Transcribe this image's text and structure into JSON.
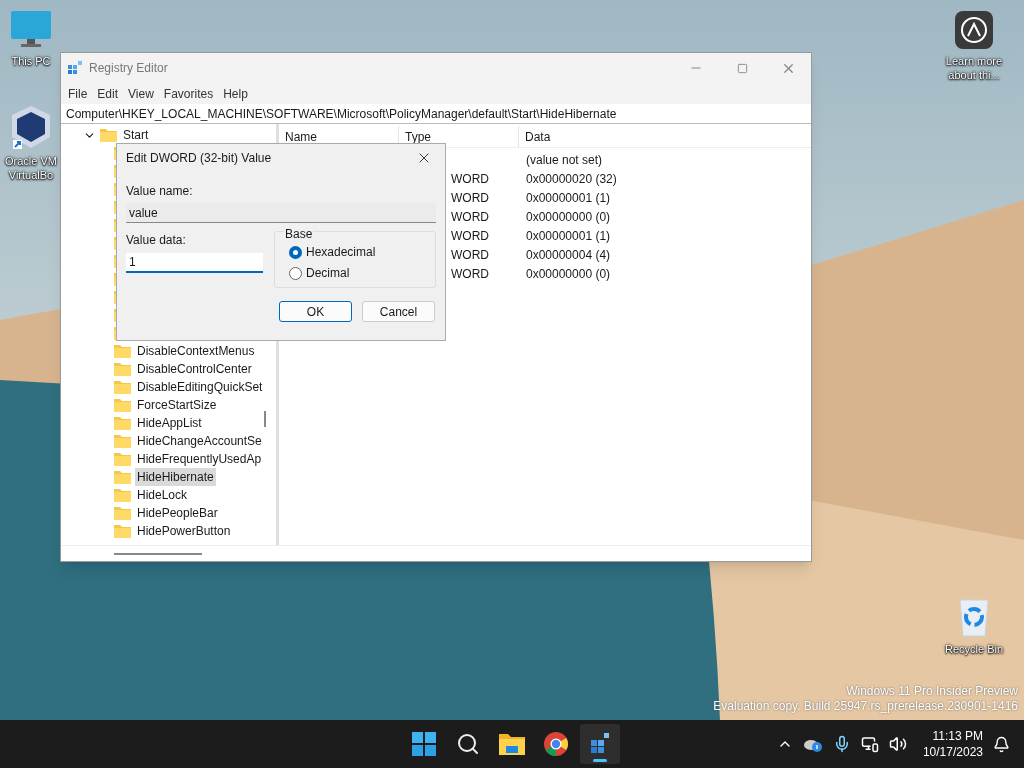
{
  "desktop_icons": [
    {
      "kind": "pc",
      "lines": [
        "This PC"
      ]
    },
    {
      "kind": "virtualbox",
      "lines": [
        "Oracle VM",
        "VirtualBo"
      ]
    },
    {
      "kind": "learn",
      "lines": [
        "Learn more",
        "about thi..."
      ]
    },
    {
      "kind": "recycle",
      "lines": [
        "Recycle Bin"
      ]
    }
  ],
  "window": {
    "title": "Registry Editor",
    "menu": [
      "File",
      "Edit",
      "View",
      "Favorites",
      "Help"
    ],
    "address": "Computer\\HKEY_LOCAL_MACHINE\\SOFTWARE\\Microsoft\\PolicyManager\\default\\Start\\HideHibernate",
    "tree": [
      {
        "label": "Start",
        "expanded": true,
        "children": [
          {
            "label": "DisableContextMenus",
            "selected": false
          },
          {
            "label": "DisableControlCenter",
            "selected": false
          },
          {
            "label": "DisableEditingQuickSet",
            "selected": false
          },
          {
            "label": "ForceStartSize",
            "selected": false
          },
          {
            "label": "HideAppList",
            "selected": false
          },
          {
            "label": "HideChangeAccountSe",
            "selected": false
          },
          {
            "label": "HideFrequentlyUsedAp",
            "selected": false
          },
          {
            "label": "HideHibernate",
            "selected": true
          },
          {
            "label": "HideLock",
            "selected": false
          },
          {
            "label": "HidePeopleBar",
            "selected": false
          },
          {
            "label": "HidePowerButton",
            "selected": false
          }
        ]
      }
    ],
    "columns": [
      "Name",
      "Type",
      "Data"
    ],
    "rows": [
      {
        "data": "(value not set)"
      },
      {
        "type": "WORD",
        "data": "0x00000020 (32)"
      },
      {
        "type": "WORD",
        "data": "0x00000001 (1)"
      },
      {
        "type": "WORD",
        "data": "0x00000000 (0)"
      },
      {
        "type": "WORD",
        "data": "0x00000001 (1)"
      },
      {
        "type": "WORD",
        "data": "0x00000004 (4)"
      },
      {
        "type": "WORD",
        "data": "0x00000000 (0)"
      }
    ]
  },
  "dialog": {
    "title": "Edit DWORD (32-bit) Value",
    "value_name_label": "Value name:",
    "value_name": "value",
    "value_data_label": "Value data:",
    "value_data": "1",
    "base_label": "Base",
    "radios": [
      {
        "label": "Hexadecimal",
        "selected": true
      },
      {
        "label": "Decimal",
        "selected": false
      }
    ],
    "buttons": [
      {
        "label": "OK",
        "default": true
      },
      {
        "label": "Cancel",
        "default": false
      }
    ]
  },
  "watermark": [
    "Windows 11 Pro Insider Preview",
    "Evaluation copy. Build 25947.rs_prerelease.230901-1416"
  ],
  "taskbar": {
    "apps": [
      {
        "kind": "start",
        "active": false
      },
      {
        "kind": "search",
        "active": false
      },
      {
        "kind": "explorer",
        "active": false
      },
      {
        "kind": "chrome",
        "active": false
      },
      {
        "kind": "regedit",
        "active": true
      }
    ],
    "time": "11:13 PM",
    "date": "10/17/2023"
  }
}
